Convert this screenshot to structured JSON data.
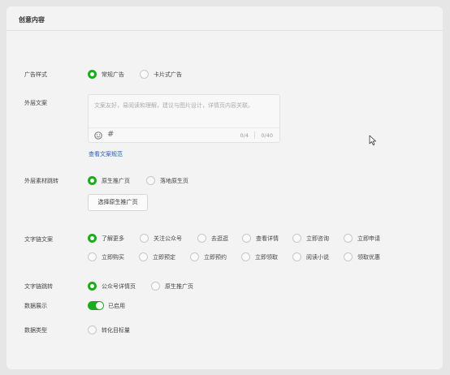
{
  "panel": {
    "title": "创意内容"
  },
  "ad_style": {
    "label": "广告样式",
    "options": [
      "常规广告",
      "卡片式广告"
    ],
    "selected": "常规广告"
  },
  "outer_copy": {
    "label": "外层文案",
    "placeholder": "文案友好，易阅读和理解，建议与图片设计，详情页内容关联。",
    "counter_left": "0/4",
    "counter_right": "0/40",
    "link": "查看文案规范"
  },
  "outer_jump": {
    "label": "外层素材跳转",
    "options": [
      "原生推广页",
      "落地原生页"
    ],
    "selected": "原生推广页",
    "button": "选择原生推广页"
  },
  "text_link_copy": {
    "label": "文字链文案",
    "row1": [
      "了解更多",
      "关注公众号",
      "去逛逛",
      "查看详情",
      "立即咨询",
      "立即申请"
    ],
    "row2": [
      "立即购买",
      "立即预定",
      "立即预约",
      "立即领取",
      "阅读小说",
      "领取优惠"
    ],
    "selected": "了解更多"
  },
  "text_link_jump": {
    "label": "文字链跳转",
    "options": [
      "公众号详情页",
      "原生推广页"
    ],
    "selected": "公众号详情页"
  },
  "data_display": {
    "label": "数据展示",
    "toggle_on": true,
    "toggle_text": "已启用"
  },
  "data_type": {
    "label": "数据类型",
    "options": [
      "转化目标量"
    ]
  },
  "colors": {
    "accent": "#1aad19",
    "link": "#2a5db0"
  },
  "icons": [
    "smile-icon",
    "hash-icon",
    "cursor-icon"
  ]
}
